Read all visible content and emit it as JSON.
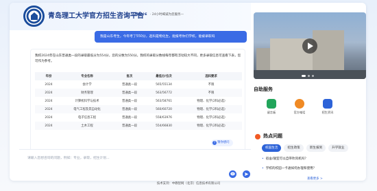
{
  "header": {
    "title": "青岛理工大学官方招生咨询平台",
    "brand": "智能小E",
    "slogan": "· 24小时竭诚为您服务—"
  },
  "chat": {
    "user_message": "我是山东考生，今年考了550分，选科是物化生，能报考你们学校，能被录取吗",
    "bot_message": "我校2024年在山东普通类一段的录取最低分为554分，您的分数为550分。我校的录取分数线每年都有浮动较大不同，更多录取信息可查看下表，您可作为参考。",
    "table": {
      "headers": [
        "年份",
        "专业名称",
        "批次",
        "最低分/位次",
        "选科要求"
      ],
      "rows": [
        [
          "2024",
          "会计学",
          "普通类一段",
          "565/55134",
          "不限"
        ],
        [
          "2024",
          "财务管理",
          "普通类一段",
          "563/56772",
          "不限"
        ],
        [
          "2024",
          "计算机科学与技术",
          "普通类一段",
          "563/58761",
          "物理、化学(2科必选)"
        ],
        [
          "2024",
          "电气工程及其自动化",
          "普通类一段",
          "560/60720",
          "物理、化学(2科必选)"
        ],
        [
          "2024",
          "电子信息工程",
          "普通类一段",
          "558/63976",
          "物理、化学(2科必选)"
        ],
        [
          "2024",
          "土木工程",
          "普通类一段",
          "554/66830",
          "物理、化学(2科必选)"
        ]
      ]
    },
    "toggle_label": "猜你想问"
  },
  "input": {
    "placeholder": "请输入您想咨询的问题，例如：专业，录取，招生计划..."
  },
  "right": {
    "service_title": "自助服务",
    "services": [
      {
        "label": "留言板",
        "icon": "message-board-icon",
        "color": "#22a55b"
      },
      {
        "label": "官方电话",
        "icon": "phone-icon",
        "color": "#f08a24"
      },
      {
        "label": "招生资讯",
        "icon": "news-icon",
        "color": "#2d63d8"
      }
    ],
    "hot_title": "热点问题",
    "hot_tabs": [
      "校园生活",
      "招生政策",
      "新生报到",
      "升学就业"
    ],
    "questions": [
      "宿舍/寝室可以自带吹风机吗？",
      "学校的校园一卡通如何办理和使用？"
    ],
    "more": "查看更多 >"
  },
  "footer": "技术支持：中教智网（北京）信息技术有限公司",
  "colors": {
    "accent": "#3a6be5",
    "title": "#1d3f8c"
  }
}
